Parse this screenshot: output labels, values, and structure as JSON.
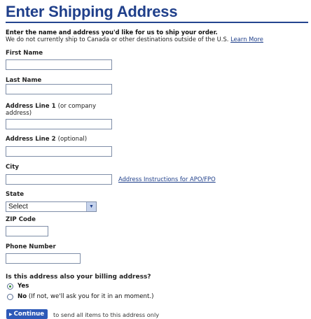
{
  "header": {
    "title": "Enter Shipping Address"
  },
  "intro": {
    "instruction": "Enter the name and address you'd like for us to ship your order.",
    "note": "We do not currently ship to Canada or other destinations outside of the U.S.",
    "learn_more": "Learn More"
  },
  "fields": {
    "first_name": {
      "label": "First Name",
      "value": ""
    },
    "last_name": {
      "label": "Last Name",
      "value": ""
    },
    "address1": {
      "label": "Address Line 1",
      "hint": "(or company address)",
      "value": ""
    },
    "address2": {
      "label": "Address Line 2",
      "hint": "(optional)",
      "value": ""
    },
    "city": {
      "label": "City",
      "value": ""
    },
    "state": {
      "label": "State",
      "selected": "Select"
    },
    "zip": {
      "label": "ZIP Code",
      "value": ""
    },
    "phone": {
      "label": "Phone Number",
      "value": ""
    }
  },
  "apo_link": "Address Instructions for APO/FPO",
  "billing": {
    "question": "Is this address also your billing address?",
    "yes_label": "Yes",
    "no_label": "No",
    "no_hint": "(If not, we'll ask you for it in an moment.)",
    "selected": "Yes"
  },
  "actions": {
    "continue_label": "Continue",
    "continue_note": "to send all items to this address only"
  },
  "colors": {
    "accent": "#1f3f8a",
    "button": "#2d59b8"
  }
}
